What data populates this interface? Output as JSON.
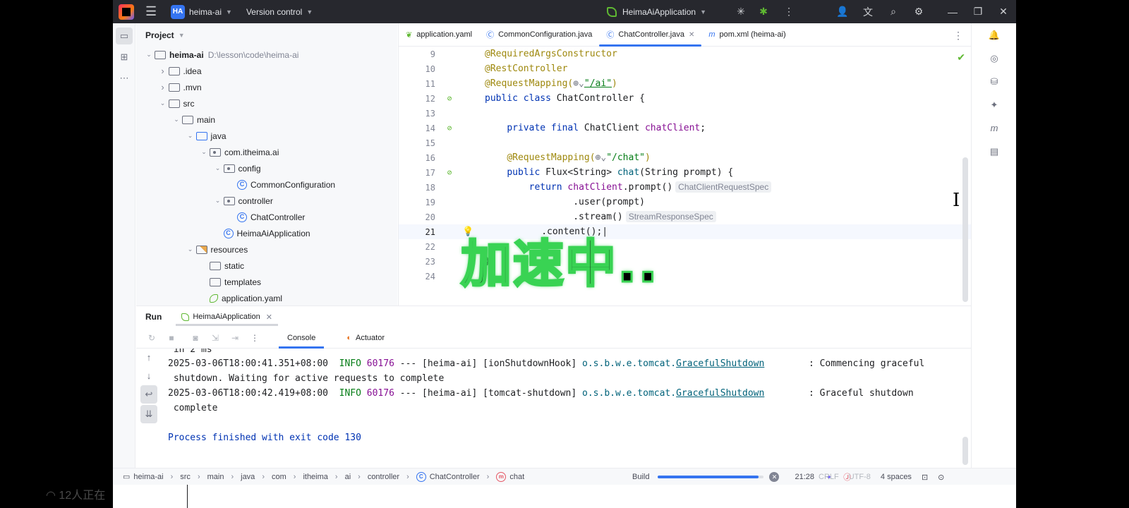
{
  "titlebar": {
    "project_badge": "HA",
    "project_name": "heima-ai",
    "version_control": "Version control",
    "run_config": "HeimaAiApplication"
  },
  "project_panel": {
    "title": "Project",
    "tree": [
      {
        "label": "heima-ai",
        "extra": "D:\\lesson\\code\\heima-ai",
        "depth": 0,
        "type": "module",
        "expanded": true
      },
      {
        "label": ".idea",
        "depth": 1,
        "type": "folder",
        "expanded": false
      },
      {
        "label": ".mvn",
        "depth": 1,
        "type": "folder",
        "expanded": false
      },
      {
        "label": "src",
        "depth": 1,
        "type": "folder",
        "expanded": true
      },
      {
        "label": "main",
        "depth": 2,
        "type": "folder",
        "expanded": true
      },
      {
        "label": "java",
        "depth": 3,
        "type": "folder-blue",
        "expanded": true
      },
      {
        "label": "com.itheima.ai",
        "depth": 4,
        "type": "package",
        "expanded": true
      },
      {
        "label": "config",
        "depth": 5,
        "type": "package",
        "expanded": true
      },
      {
        "label": "CommonConfiguration",
        "depth": 6,
        "type": "class"
      },
      {
        "label": "controller",
        "depth": 5,
        "type": "package",
        "expanded": true
      },
      {
        "label": "ChatController",
        "depth": 6,
        "type": "class"
      },
      {
        "label": "HeimaAiApplication",
        "depth": 5,
        "type": "class"
      },
      {
        "label": "resources",
        "depth": 3,
        "type": "folder-res",
        "expanded": true
      },
      {
        "label": "static",
        "depth": 4,
        "type": "folder"
      },
      {
        "label": "templates",
        "depth": 4,
        "type": "folder"
      },
      {
        "label": "application.yaml",
        "depth": 4,
        "type": "yaml"
      }
    ]
  },
  "editor": {
    "tabs": [
      {
        "label": "application.yaml",
        "icon": "yaml-icon",
        "active": false
      },
      {
        "label": "CommonConfiguration.java",
        "icon": "class-icon",
        "active": false
      },
      {
        "label": "ChatController.java",
        "icon": "class-icon",
        "active": true
      },
      {
        "label": "pom.xml (heima-ai)",
        "icon": "maven-icon",
        "active": false
      }
    ],
    "line_numbers": [
      "9",
      "10",
      "11",
      "12",
      "13",
      "14",
      "15",
      "16",
      "17",
      "18",
      "19",
      "20",
      "21",
      "22",
      "23",
      "24"
    ],
    "code": {
      "l9": "@RequiredArgsConstructor",
      "l10": "@RestController",
      "l11_a": "@RequestMapping(",
      "l11_b": "\"/ai\"",
      "l11_c": ")",
      "l12_kw": "public class ",
      "l12_name": "ChatController {",
      "l14_kw": "private final ",
      "l14_type": "ChatClient ",
      "l14_field": "chatClient",
      "l14_end": ";",
      "l16_a": "@RequestMapping(",
      "l16_b": "\"/chat\"",
      "l16_c": ")",
      "l17_kw": "public ",
      "l17_type": "Flux<String> ",
      "l17_method": "chat",
      "l17_rest": "(String prompt) {",
      "l18_kw": "return ",
      "l18_field": "chatClient",
      "l18_rest": ".prompt()",
      "l18_hint": "ChatClientRequestSpec",
      "l19": ".user(prompt)",
      "l20": ".stream()",
      "l20_hint": "StreamResponseSpec",
      "l21": ".content();",
      "l23": "}"
    },
    "overlay_text": "加速中.."
  },
  "run_panel": {
    "title": "Run",
    "config_tab": "HeimaAiApplication",
    "console_tab": "Console",
    "actuator_tab": "Actuator",
    "lines": {
      "l0": " in 2 ms",
      "l1_time": "2025-03-06T18:00:41.351+08:00  ",
      "l1_level": "INFO",
      "l1_pid": " 60176",
      "l1_mid": " --- [heima-ai] [ionShutdownHook] ",
      "l1_logger_pkg": "o.s.b.w.e.tomcat.",
      "l1_logger_cls": "GracefulShutdown",
      "l1_msg": "        : Commencing graceful",
      "l2": " shutdown. Waiting for active requests to complete",
      "l3_time": "2025-03-06T18:00:42.419+08:00  ",
      "l3_level": "INFO",
      "l3_pid": " 60176",
      "l3_mid": " --- [heima-ai] [tomcat-shutdown] ",
      "l3_logger_pkg": "o.s.b.w.e.tomcat.",
      "l3_logger_cls": "GracefulShutdown",
      "l3_msg": "        : Graceful shutdown",
      "l4": " complete",
      "l6": "Process finished with exit code 130"
    }
  },
  "statusbar": {
    "breadcrumbs": [
      "heima-ai",
      "src",
      "main",
      "java",
      "com",
      "itheima",
      "ai",
      "controller",
      "ChatController",
      "chat"
    ],
    "build_label": "Build",
    "build_progress": 0.95,
    "cursor_pos": "21:28",
    "encoding": "CRLF",
    "charset": "UTF-8",
    "indent": "4 spaces"
  },
  "overlay": {
    "viewers": "12人正在"
  },
  "colors": {
    "accent": "#3574f0",
    "overlay_glow": "#39d353",
    "spring_green": "#5fb832"
  }
}
